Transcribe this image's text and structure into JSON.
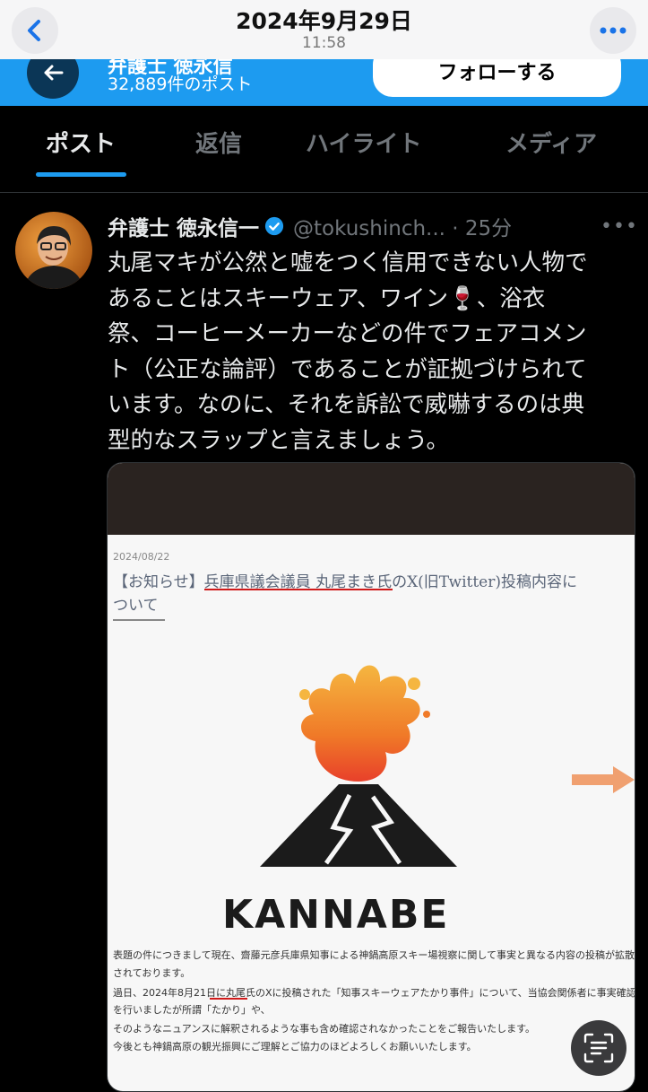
{
  "status": {
    "date": "2024年9月29日",
    "time": "11:58"
  },
  "profile_bar": {
    "name": "弁護士 徳永信",
    "post_count": "32,889件のポスト",
    "follow_label": "フォローする"
  },
  "tabs": [
    {
      "label": "ポスト",
      "active": true
    },
    {
      "label": "返信"
    },
    {
      "label": "ハイライト"
    },
    {
      "label": "メディア"
    }
  ],
  "post": {
    "author": "弁護士 徳永信一",
    "handle": "@tokushinch... · 25分",
    "more": "•••",
    "lines": [
      "丸尾マキが公然と嘘をつく信用できない人物で",
      "あることはスキーウェア、ワイン🍷、浴衣",
      "祭、コーヒーメーカーなどの件でフェアコメン",
      "ト（公正な論評）であることが証拠づけられて",
      "います。なのに、それを訴訟で威嚇するのは典",
      "型的なスラップと言えましょう。"
    ]
  },
  "media": {
    "date": "2024/08/22",
    "title_line1": "【お知らせ】兵庫県議会議員 丸尾まき氏のX(旧Twitter)投稿内容に",
    "title_line2": "ついて",
    "logo_text": "KANNABE",
    "body": [
      "表題の件につきまして現在、齋藤元彦兵庫県知事による神鍋高原スキー場視察に関して事実と異なる内容の投稿が拡散",
      "されております。",
      "過日、2024年8月21日に丸尾氏のXに投稿された「知事スキーウェアたかり事件」について、当協会関係者に事実確認",
      "を行いましたが所謂「たかり」や、",
      "そのようなニュアンスに解釈されるような事も含め確認されなかったことをご報告いたします。",
      "今後とも神鍋高原の観光振興にご理解とご協力のほどよろしくお願いいたします。"
    ]
  },
  "colors": {
    "accent": "#1d9bf0",
    "background": "#000000",
    "text": "#e7e9ea",
    "muted": "#71767b"
  }
}
